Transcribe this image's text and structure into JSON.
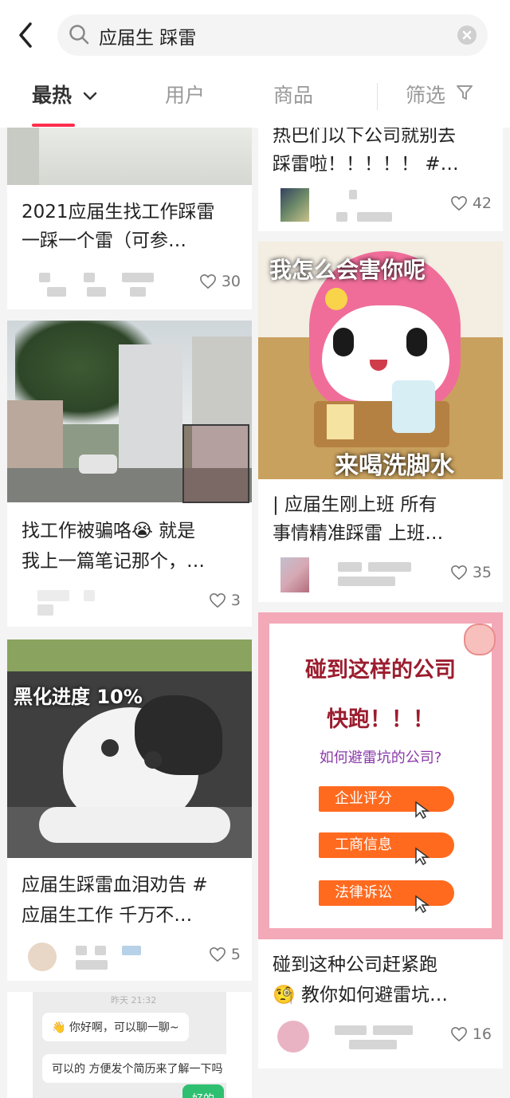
{
  "search": {
    "query": "应届生 踩雷"
  },
  "tabs": [
    {
      "label": "最热"
    },
    {
      "label": "用户"
    },
    {
      "label": "商品"
    },
    {
      "label": "筛选"
    }
  ],
  "left_cards": [
    {
      "title1": "2021应届生找工作踩雷",
      "title2": "一踩一个雷（可参…",
      "likes": "30"
    },
    {
      "title1": "找工作被骗咯😭 就是",
      "title2": "我上一篇笔记那个，…",
      "likes": "3"
    },
    {
      "image_text": "黑化进度 10%",
      "title1": "应届生踩雷血泪劝告 #",
      "title2": "应届生工作 千万不…",
      "likes": "5"
    },
    {
      "chat": {
        "time": "昨天 21:32",
        "msg1": "👋 你好啊，可以聊一聊~",
        "msg2": "可以的  方便发个简历来了解一下吗",
        "reply": "好的"
      }
    }
  ],
  "right_cards": [
    {
      "title1": "热巴们以下公司就别去",
      "title2": "踩雷啦！！！！！ #…",
      "likes": "42"
    },
    {
      "image_text_top": "我怎么会害你呢",
      "image_text_bottom": "来喝洗脚水",
      "title1": "| 应届生刚上班 所有",
      "title2": "事情精准踩雷 上班…",
      "likes": "35"
    },
    {
      "poster": {
        "line1": "碰到这样的公司",
        "line2": "快跑！！！",
        "line3": "如何避雷坑的公司?",
        "chips": [
          "企业评分",
          "工商信息",
          "法律诉讼"
        ]
      },
      "title1": "碰到这种公司赶紧跑",
      "title2": "🧐 教你如何避雷坑…",
      "likes": "16"
    }
  ],
  "colors": {
    "accent": "#ff2e4d",
    "chip": "#ff6a1f",
    "poster_frame": "#f4a9b8",
    "poster_title": "#9b1d2e"
  }
}
